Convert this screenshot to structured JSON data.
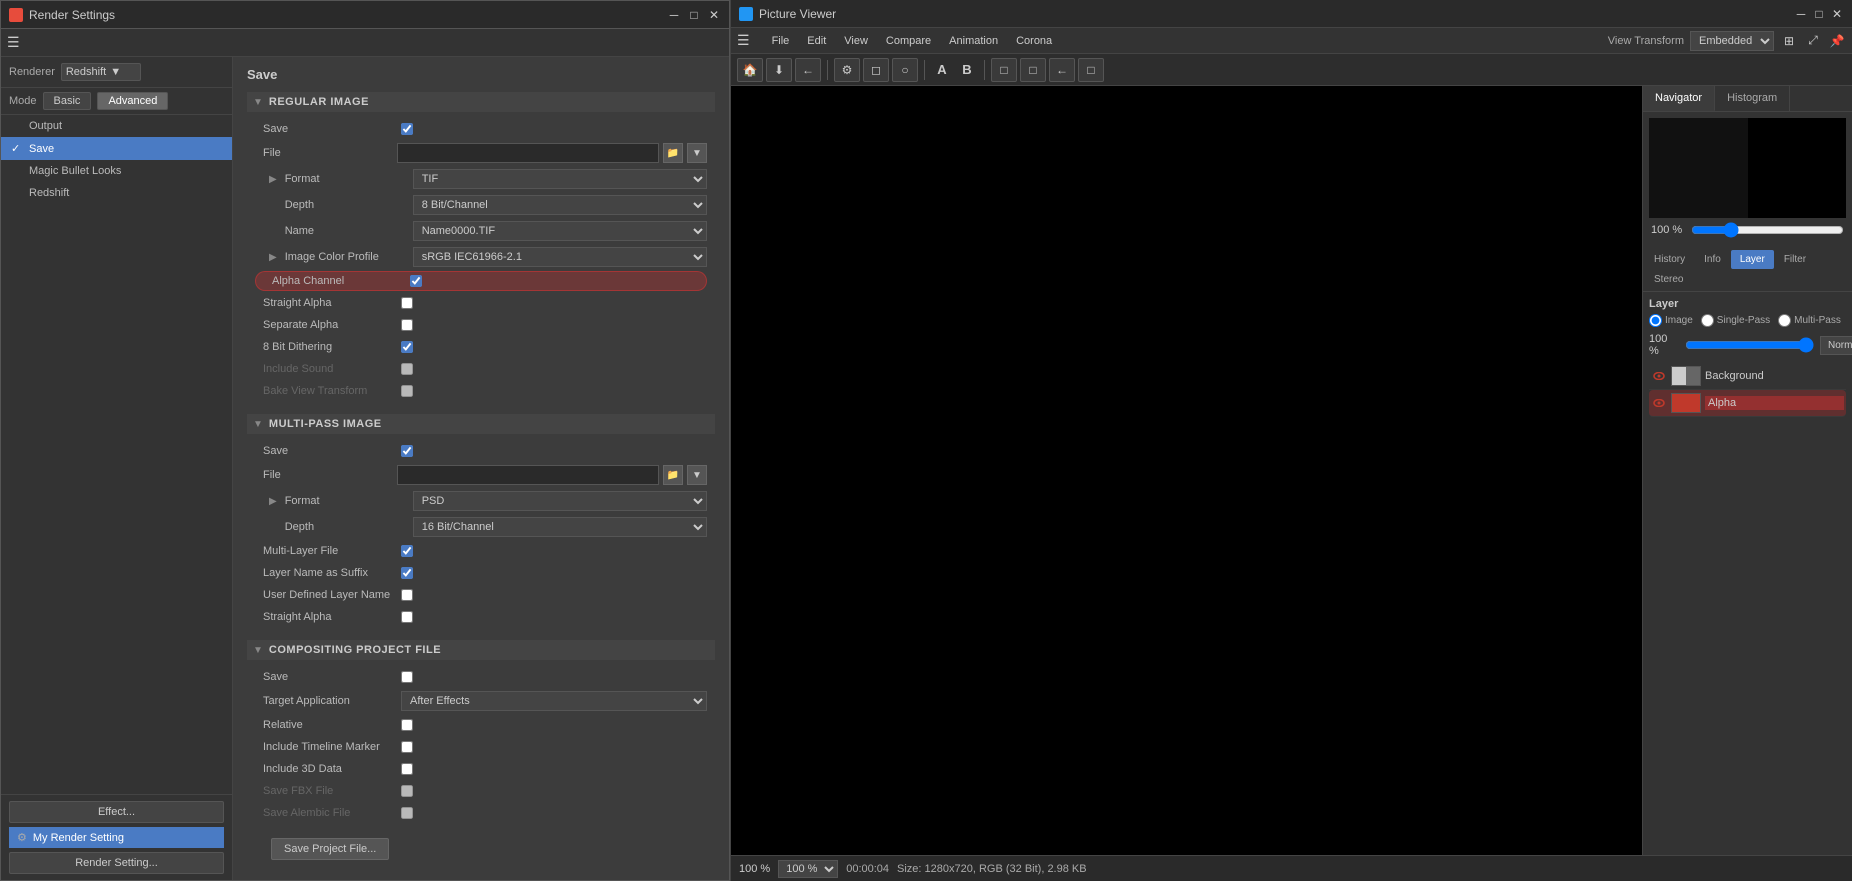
{
  "renderSettings": {
    "title": "Render Settings",
    "menuIcon": "☰",
    "renderer": {
      "label": "Renderer",
      "value": "Redshift"
    },
    "mode": {
      "label": "Mode",
      "basic": "Basic",
      "advanced": "Advanced"
    },
    "navItems": [
      {
        "id": "output",
        "label": "Output",
        "checked": false
      },
      {
        "id": "save",
        "label": "Save",
        "checked": true,
        "active": true
      },
      {
        "id": "magic-bullet",
        "label": "Magic Bullet Looks",
        "checked": false
      },
      {
        "id": "redshift",
        "label": "Redshift",
        "checked": false
      }
    ],
    "effectBtn": "Effect...",
    "renderSettingItem": "My Render Setting",
    "renderSettingBtn": "Render Setting...",
    "saveTitle": "Save",
    "regularImage": {
      "sectionTitle": "REGULAR IMAGE",
      "saveLabel": "Save",
      "fileLabel": "File",
      "formatLabel": "Format",
      "formatValue": "TIF",
      "depthLabel": "Depth",
      "depthValue": "8 Bit/Channel",
      "nameLabel": "Name",
      "nameValue": "Name0000.TIF",
      "imageColorProfileLabel": "Image Color Profile",
      "imageColorProfileValue": "sRGB IEC61966-2.1",
      "alphaChannelLabel": "Alpha Channel",
      "alphaChannelChecked": true,
      "straightAlphaLabel": "Straight Alpha",
      "straightAlphaChecked": false,
      "separateAlphaLabel": "Separate Alpha",
      "separateAlphaChecked": false,
      "bitDitheringLabel": "8 Bit Dithering",
      "bitDitheringChecked": true,
      "includeSoundLabel": "Include Sound",
      "includeSoundChecked": false,
      "bakeViewTransformLabel": "Bake View Transform",
      "bakeViewTransformChecked": false
    },
    "multiPassImage": {
      "sectionTitle": "MULTI-PASS IMAGE",
      "saveLabel": "Save",
      "fileLabel": "File",
      "formatLabel": "Format",
      "formatValue": "PSD",
      "depthLabel": "Depth",
      "depthValue": "16 Bit/Channel",
      "multiLayerFileLabel": "Multi-Layer File",
      "multiLayerFileChecked": true,
      "layerNameAsSuffixLabel": "Layer Name as Suffix",
      "layerNameAsSuffixChecked": true,
      "userDefinedLayerNameLabel": "User Defined Layer Name",
      "userDefinedLayerNameChecked": false,
      "straightAlphaLabel": "Straight Alpha",
      "straightAlphaChecked": false
    },
    "compositingProject": {
      "sectionTitle": "COMPOSITING PROJECT FILE",
      "saveLabel": "Save",
      "saveChecked": false,
      "targetApplicationLabel": "Target Application",
      "targetApplicationValue": "After Effects",
      "relativeLabel": "Relative",
      "relativeChecked": false,
      "includeTimelineMarkerLabel": "Include Timeline Marker",
      "includeTimelineMarkerChecked": false,
      "include3DDataLabel": "Include 3D Data",
      "include3DDataChecked": false,
      "saveFBXFileLabel": "Save FBX File",
      "saveFBXFileChecked": false,
      "saveAlembicFileLabel": "Save Alembic File",
      "saveAlembicFileChecked": false,
      "saveProjectFileBtn": "Save Project File..."
    }
  },
  "pictureViewer": {
    "title": "Picture Viewer",
    "viewTransformLabel": "View Transform",
    "viewTransformValue": "Embedded",
    "menuItems": [
      "File",
      "Edit",
      "View",
      "Compare",
      "Animation",
      "Corona"
    ],
    "hamburgerIcon": "☰",
    "toolbar": {
      "buttons": [
        "🏠",
        "⬇",
        "←",
        "⚙",
        "◻",
        "○",
        "A",
        "B",
        "□",
        "□",
        "←",
        "□"
      ]
    },
    "tabs": {
      "navigator": "Navigator",
      "histogram": "Histogram"
    },
    "subtabs": [
      "History",
      "Info",
      "Layer",
      "Filter",
      "Stereo"
    ],
    "activeSubtab": "Layer",
    "layer": {
      "header": "Layer",
      "radioImage": "Image",
      "radioSinglePass": "Single-Pass",
      "radioMultiPass": "Multi-Pass",
      "opacityValue": "100 %",
      "modeValue": "Normal",
      "items": [
        {
          "id": "background",
          "name": "Background",
          "thumbType": "bg",
          "eyeVisible": true
        },
        {
          "id": "alpha",
          "name": "Alpha",
          "thumbType": "alpha",
          "highlighted": true
        }
      ]
    },
    "navigatorZoom": "100 %",
    "statusBar": {
      "zoomValue": "100 %",
      "timeCode": "00:00:04",
      "sizeInfo": "Size: 1280x720, RGB (32 Bit), 2.98 KB"
    }
  }
}
